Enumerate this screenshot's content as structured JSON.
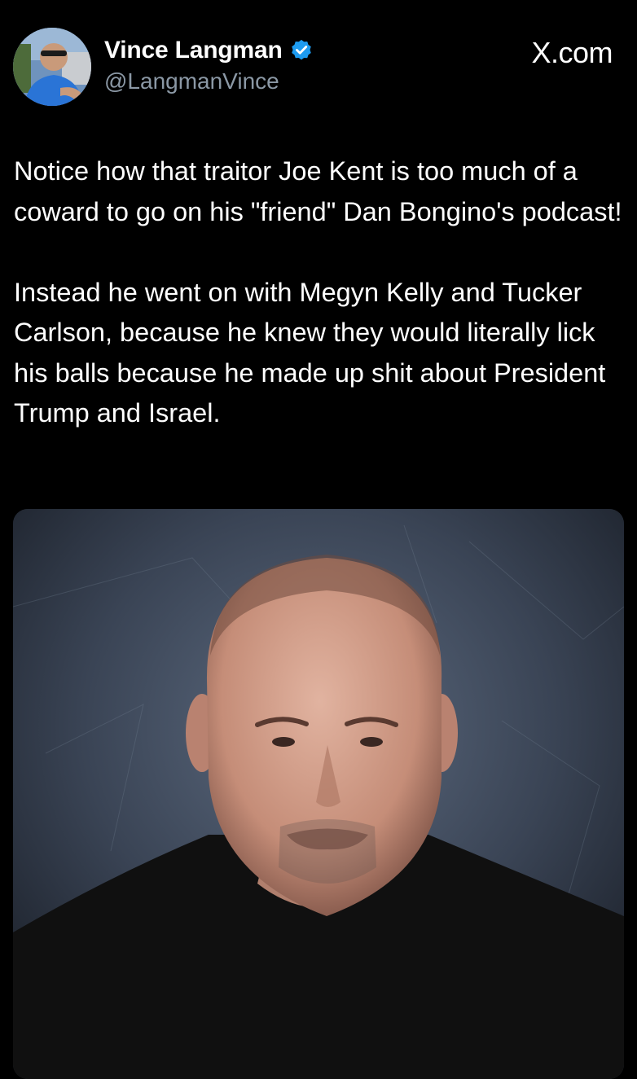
{
  "header": {
    "display_name": "Vince Langman",
    "handle": "@LangmanVince",
    "site_label": "X.com",
    "verified_badge_color": "#1d9bf0"
  },
  "tweet": {
    "paragraphs": [
      "Notice how that traitor Joe Kent is too much of a coward to go on his \"friend\" Dan Bongino's podcast!",
      "Instead he went on with Megyn Kelly and Tucker Carlson, because he knew they would literally lick his balls because he made up shit about President Trump and Israel."
    ]
  },
  "media": {
    "icon": "photo-portrait"
  },
  "colors": {
    "background": "#000000",
    "text": "#ffffff",
    "secondary_text": "#8b98a5",
    "accent": "#1d9bf0"
  }
}
